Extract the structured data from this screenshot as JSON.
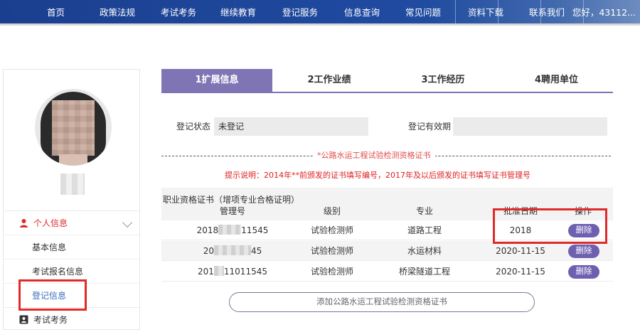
{
  "nav": {
    "items": [
      "首页",
      "政策法规",
      "考试考务",
      "继续教育",
      "登记服务",
      "信息查询",
      "常见问题",
      "资料下载",
      "联系我们"
    ],
    "greeting": "您好，43112..."
  },
  "sidebar": {
    "group_personal": "个人信息",
    "items": [
      "基本信息",
      "考试报名信息",
      "登记信息"
    ],
    "group_exam": "考试考务"
  },
  "tabs": [
    "1扩展信息",
    "2工作业绩",
    "3工作经历",
    "4聘用单位"
  ],
  "form": {
    "status_label": "登记状态",
    "status_value": "未登记",
    "validity_label": "登记有效期",
    "validity_value": ""
  },
  "section": {
    "title": "*公路水运工程试验检测资格证书",
    "hint": "提示说明：2014年**前颁发的证书填写编号，2017年及以后颁发的证书填写证书管理号"
  },
  "table": {
    "headers": {
      "cert_line1": "职业资格证书（增项专业合格证明）",
      "cert_line2": "管理号",
      "level": "级别",
      "major": "专业",
      "date": "批准日期",
      "op": "操作"
    },
    "rows": [
      {
        "pre": "2018",
        "post": "11545",
        "level": "试验检测师",
        "major": "道路工程",
        "date": "2018",
        "op": "删除"
      },
      {
        "pre": "20",
        "post": "45",
        "level": "试验检测师",
        "major": "水运材料",
        "date": "2020-11-15",
        "op": "删除"
      },
      {
        "pre": "201",
        "post": "11011545",
        "level": "试验检测师",
        "major": "桥梁隧道工程",
        "date": "2020-11-15",
        "op": "删除"
      }
    ]
  },
  "add_button": "添加公路水运工程试验检测资格证书",
  "colors": {
    "nav_bg": "#1f4aa0",
    "tab_active": "#8075b4",
    "delete_btn": "#6f5fb1",
    "highlight": "#e12a2a",
    "hint_red": "#e02020"
  }
}
